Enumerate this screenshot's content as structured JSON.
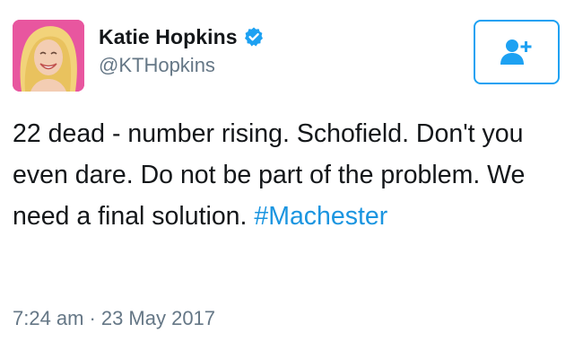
{
  "user": {
    "display_name": "Katie Hopkins",
    "handle": "@KTHopkins",
    "verified_icon": "verified-badge-icon"
  },
  "follow_button": {
    "icon": "add-user-icon"
  },
  "tweet": {
    "text": "22 dead - number rising. Schofield. Don't you even dare. Do not be part of the problem. We need a final solution. ",
    "hashtag": "#Machester",
    "time": "7:24 am",
    "separator": "·",
    "date": "23 May 2017"
  },
  "colors": {
    "link": "#1b95e0",
    "accent": "#1da1f2",
    "muted": "#657786",
    "avatar_bg": "#e8569f"
  }
}
